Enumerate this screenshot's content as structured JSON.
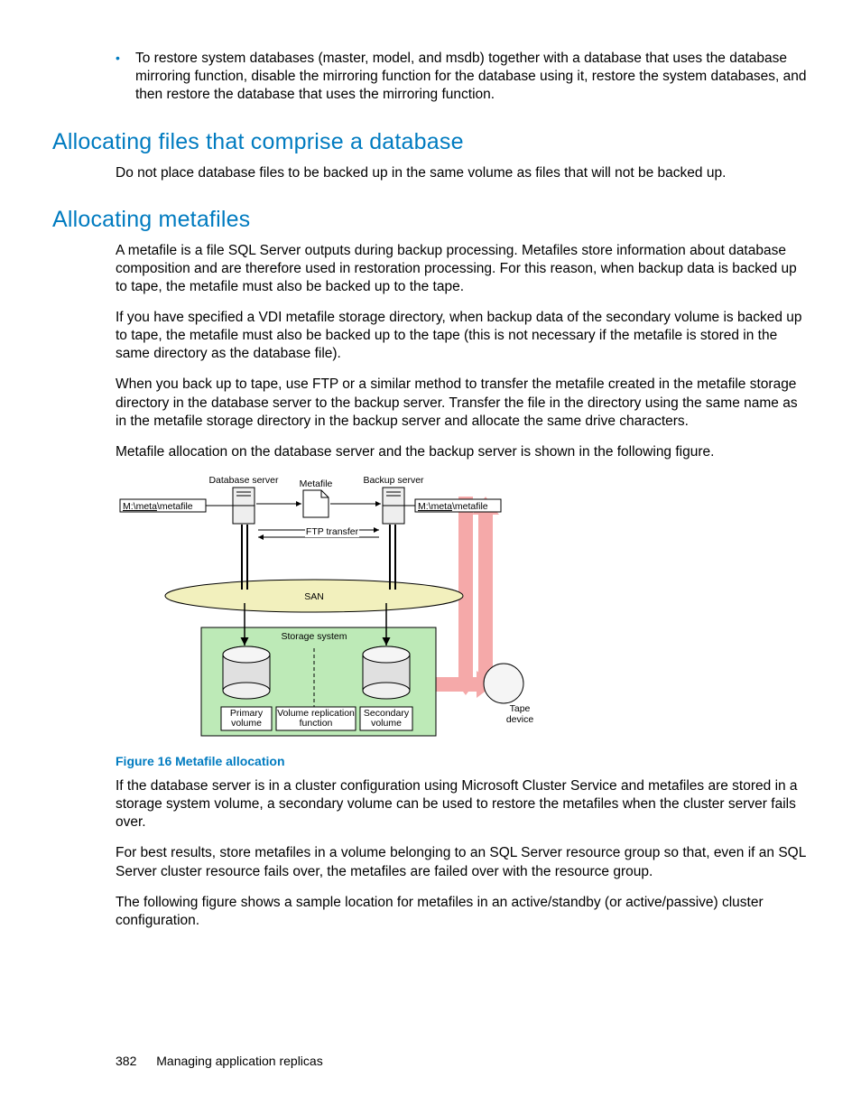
{
  "bullets": [
    "To restore system databases (master, model, and msdb) together with a database that uses the database mirroring function, disable the mirroring function for the database using it, restore the system databases, and then restore the database that uses the mirroring function."
  ],
  "sec1": {
    "heading": "Allocating files that comprise a database",
    "p1": "Do not place database files to be backed up in the same volume as files that will not be backed up."
  },
  "sec2": {
    "heading": "Allocating metafiles",
    "p1": "A metafile is a file SQL Server outputs during backup processing. Metafiles store information about database composition and are therefore used in restoration processing. For this reason, when backup data is backed up to tape, the metafile must also be backed up to the tape.",
    "p2": "If you have specified a VDI metafile storage directory, when backup data of the secondary volume is backed up to tape, the metafile must also be backed up to the tape (this is not necessary if the metafile is stored in the same directory as the database file).",
    "p3": "When you back up to tape, use FTP or a similar method to transfer the metafile created in the metafile storage directory in the database server to the backup server. Transfer the file in the directory using the same name as in the metafile storage directory in the backup server and allocate the same drive characters.",
    "p4": "Metafile allocation on the database server and the backup server is shown in the following figure."
  },
  "figure": {
    "caption": "Figure 16 Metafile allocation",
    "db_server": "Database server",
    "bk_server": "Backup server",
    "metafile": "Metafile",
    "path_left": "M:\\meta\\metafile",
    "path_right": "M:\\meta\\metafile",
    "ftp": "FTP transfer",
    "san": "SAN",
    "storage": "Storage system",
    "pvol": "Primary\nvolume",
    "svol": "Secondary\nvolume",
    "vrf": "Volume replication\nfunction",
    "tape": "Tape\ndevice"
  },
  "after": {
    "p1": "If the database server is in a cluster configuration using Microsoft Cluster Service and metafiles are stored in a storage system volume, a secondary volume can be used to restore the metafiles when the cluster server fails over.",
    "p2": "For best results, store metafiles in a volume belonging to an SQL Server resource group so that, even if an SQL Server cluster resource fails over, the metafiles are failed over with the resource group.",
    "p3": "The following figure shows a sample location for metafiles in an active/standby (or active/passive) cluster configuration."
  },
  "footer": {
    "page": "382",
    "title": "Managing application replicas"
  }
}
